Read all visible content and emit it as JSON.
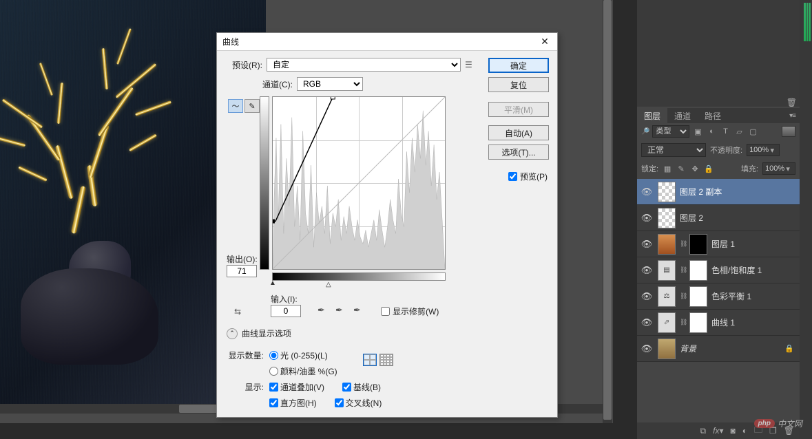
{
  "dialog": {
    "title": "曲线",
    "preset_label": "预设(R):",
    "preset_value": "自定",
    "channel_label": "通道(C):",
    "channel_value": "RGB",
    "btn_ok": "确定",
    "btn_cancel": "复位",
    "btn_smooth": "平滑(M)",
    "btn_auto": "自动(A)",
    "btn_options": "选项(T)...",
    "preview": "预览(P)",
    "output_label": "输出(O):",
    "output_value": "71",
    "input_label": "输入(I):",
    "input_value": "0",
    "show_clip": "显示修剪(W)",
    "display_options": "曲线显示选项",
    "amount_label": "显示数量:",
    "light": "光 (0-255)(L)",
    "ink": "颜料/油墨 %(G)",
    "show_label": "显示:",
    "channel_overlay": "通道叠加(V)",
    "histogram": "直方图(H)",
    "baseline": "基线(B)",
    "intersection": "交叉线(N)"
  },
  "panel": {
    "tab_layers": "图层",
    "tab_channels": "通道",
    "tab_paths": "路径",
    "filter_label": "类型",
    "blend_mode": "正常",
    "opacity_label": "不透明度:",
    "opacity_value": "100%",
    "lock_label": "锁定:",
    "fill_label": "填充:",
    "fill_value": "100%",
    "layers": [
      {
        "name": "图层 2 副本"
      },
      {
        "name": "图层 2"
      },
      {
        "name": "图层 1"
      },
      {
        "name": "色相/饱和度 1"
      },
      {
        "name": "色彩平衡 1"
      },
      {
        "name": "曲线 1"
      },
      {
        "name": "背景"
      }
    ]
  },
  "watermark": {
    "badge": "php",
    "text": "中文网"
  }
}
